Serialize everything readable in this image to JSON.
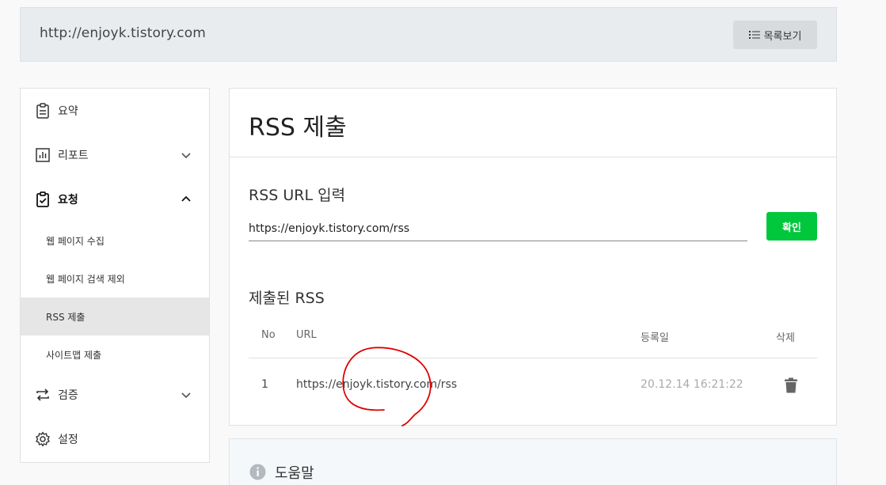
{
  "header": {
    "site_url": "http://enjoyk.tistory.com",
    "list_button": "목록보기"
  },
  "sidebar": {
    "summary": "요약",
    "report": "리포트",
    "request": "요청",
    "request_items": [
      "웹 페이지 수집",
      "웹 페이지 검색 제외",
      "RSS 제출",
      "사이트맵 제출"
    ],
    "verify": "검증",
    "settings": "설정"
  },
  "main": {
    "title": "RSS 제출",
    "input_label": "RSS URL 입력",
    "input_value": "https://enjoyk.tistory.com/rss",
    "confirm_button": "확인",
    "submitted_label": "제출된 RSS",
    "table": {
      "columns": [
        "No",
        "URL",
        "등록일",
        "삭제"
      ],
      "rows": [
        {
          "no": "1",
          "url": "https://enjoyk.tistory.com/rss",
          "date": "20.12.14 16:21:22"
        }
      ]
    }
  },
  "help": {
    "title": "도움말"
  },
  "icons": {
    "list": "list-icon",
    "summary": "clipboard-icon",
    "report": "bar-chart-icon",
    "request": "clipboard-check-icon",
    "verify": "repeat-icon",
    "settings": "gear-icon",
    "delete": "trash-icon",
    "help": "info-icon"
  },
  "colors": {
    "accent": "#00c73c",
    "active_bg": "#e6e6e6",
    "annotation": "#e00000"
  }
}
